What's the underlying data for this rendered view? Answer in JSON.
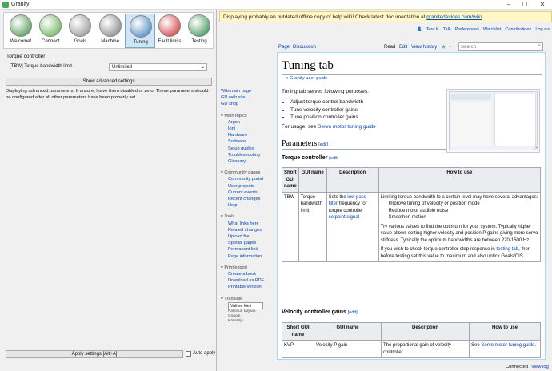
{
  "window": {
    "title": "Granity",
    "min": "–",
    "max": "☐",
    "close": "✕"
  },
  "toolbar": [
    {
      "label": "Welcome!",
      "icon": "welcome-icon",
      "color": "#3a8a3a"
    },
    {
      "label": "Connect",
      "icon": "connect-icon",
      "color": "#55aa44"
    },
    {
      "label": "Goals",
      "icon": "goals-icon",
      "color": "#888888"
    },
    {
      "label": "Machine",
      "icon": "machine-icon",
      "color": "#777777"
    },
    {
      "label": "Tuning",
      "icon": "tuning-icon",
      "color": "#3377bb"
    },
    {
      "label": "Fault limits",
      "icon": "traffic-light-icon",
      "color": "#cc2222"
    },
    {
      "label": "Testing",
      "icon": "testing-icon",
      "color": "#228844"
    }
  ],
  "settings": {
    "group": "Torque controller",
    "param_label": "[TBW] Torque bandwidth limit",
    "param_value": "Unlimited",
    "show_advanced": "Show advanced settings",
    "note": "Displaying advanced parameters. If unsure, leave them disabled or zero. These parameters should be configured after all other parameters have been properly set.",
    "apply": "Apply settings [Alt+A]",
    "auto_apply": "Auto apply"
  },
  "helpbar": {
    "text": "Displaying probably an outdated offline copy of help wiki! Check latest documentation at ",
    "link": "granitedevices.com/wiki"
  },
  "userlinks": [
    "Tero K",
    "Talk",
    "Preferences",
    "Watchlist",
    "Contributions",
    "Log out"
  ],
  "tabs": {
    "page": "Page",
    "discussion": "Discussion",
    "read": "Read",
    "edit": "Edit",
    "history": "View history",
    "search_placeholder": "Search"
  },
  "sidebar": {
    "top": [
      "Wiki main page",
      "GD web site",
      "GD shop"
    ],
    "groups": [
      {
        "title": "Main topics",
        "items": [
          "Argon",
          "Ioni",
          "Hardware",
          "Software",
          "Setup guides",
          "Troubleshooting",
          "Glossary"
        ]
      },
      {
        "title": "Community pages",
        "items": [
          "Community portal",
          "User projects",
          "Current events",
          "Recent changes",
          "Help"
        ]
      },
      {
        "title": "Tools",
        "items": [
          "What links here",
          "Related changes",
          "Upload file",
          "Special pages",
          "Permanent link",
          "Page information"
        ]
      },
      {
        "title": "Print/export",
        "items": [
          "Create a book",
          "Download as PDF",
          "Printable version"
        ]
      }
    ],
    "translate": "Translate",
    "lang_select": "Valitse kieli",
    "powered": "Palvelun tarjoaa",
    "google": "Google",
    "kaantaja": "Kääntäjä"
  },
  "article": {
    "title": "Tuning tab",
    "breadcrumb": "< Granity user guide",
    "intro": "Tuning tab serves following purposes:",
    "purposes": [
      "Adjust torque control bandwidth",
      "Tune velocity controller gains",
      "Tune position controller gains"
    ],
    "usage_pre": "For usage, see ",
    "usage_link": "Servo motor tuning guide",
    "params": "Parameters",
    "edit": "[edit]",
    "torque_title": "Torque controller",
    "headers": [
      "Short GUI name",
      "GUI name",
      "Description",
      "How to use"
    ],
    "tbw": {
      "short": "TBW",
      "name": "Torque bandwidth limit",
      "desc_a": "Sets the ",
      "desc_link1": "low pass filter",
      "desc_b": " frequency for torque controller ",
      "desc_link2": "setpoint signal",
      "how1": "Limiting torque bandwidth to a certain level may have several advantages:",
      "bullets": [
        "Improve tuning of velocity or position mode",
        "Reduce motor audible noise",
        "Smoothen motion"
      ],
      "how2": "Try various values to find the optimum for your system. Typically higher value allows setting higher velocity and position P gains giving more servo stiffness. Typically the optimum bandwidths are between 220-1500 Hz",
      "how3a": "If you wish to check torque controller step response in ",
      "how3link": "testing tab",
      "how3b": ", then before testing set this value to maximum and also untick Goals/CIS."
    },
    "vel_title": "Velocity controller gains",
    "kvp": {
      "short": "KVP",
      "name": "Velocity P gain",
      "desc": "The proportional gain of velocity controller",
      "how_a": "See ",
      "how_link": "Servo motor tuning guide",
      "how_b": "."
    }
  },
  "status": {
    "connected": "Connected",
    "viewlog": "View log"
  }
}
